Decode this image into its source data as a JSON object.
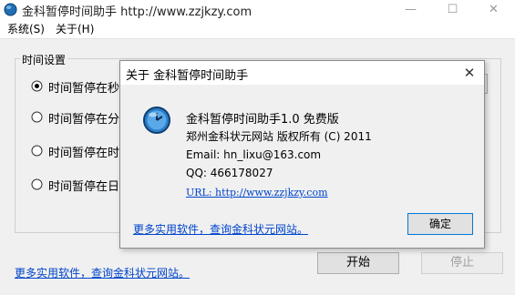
{
  "window": {
    "title": "金科暂停时间助手 http://www.zzjkzy.com",
    "min_glyph": "—",
    "max_glyph": "☐",
    "close_glyph": "✕"
  },
  "menu": {
    "system": "系统(S)",
    "about": "关于(H)"
  },
  "group": {
    "title": "时间设置",
    "options": [
      {
        "label": "时间暂停在秒",
        "selected": true
      },
      {
        "label": "时间暂停在分",
        "selected": false
      },
      {
        "label": "时间暂停在时",
        "selected": false
      },
      {
        "label": "时间暂停在日",
        "selected": false
      }
    ]
  },
  "main_link": "更多实用软件，查询金科状元网站。",
  "buttons": {
    "start": "开始",
    "stop": "停止"
  },
  "about": {
    "title": "关于 金科暂停时间助手",
    "close_glyph": "✕",
    "name_line": "金科暂停时间助手1.0  免费版",
    "copyright": "郑州金科状元网站 版权所有 (C) 2011",
    "email": "Email:  hn_lixu@163.com",
    "qq": "QQ:  466178027",
    "url": "URL: http://www.zzjkzy.com",
    "link": "更多实用软件，查询金科状元网站。",
    "ok": "确定"
  },
  "colors": {
    "link": "#0044cc",
    "app_icon": "#1f6fb5"
  },
  "icons": [
    "app-globe-icon",
    "clock-icon"
  ]
}
